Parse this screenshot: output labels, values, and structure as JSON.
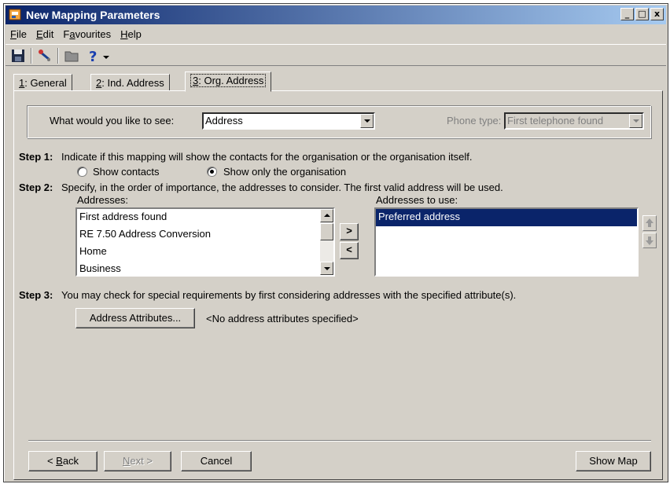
{
  "window": {
    "title": "New Mapping Parameters",
    "controls": {
      "minimize": "_",
      "maximize": "□",
      "close": "x"
    }
  },
  "menu": [
    {
      "key": "F",
      "rest": "ile"
    },
    {
      "key": "E",
      "rest": "dit"
    },
    {
      "pre": "F",
      "key": "a",
      "rest": "vourites"
    },
    {
      "key": "H",
      "rest": "elp"
    }
  ],
  "toolbar": {
    "icons": [
      "save-icon",
      "map-pin-icon",
      "folder-icon",
      "help-icon",
      "dropdown-arrow-icon"
    ]
  },
  "tabs": [
    {
      "key": "1",
      "rest": ": General"
    },
    {
      "key": "2",
      "rest": ": Ind. Address"
    },
    {
      "key": "3",
      "rest": ": Org. Address"
    }
  ],
  "view": {
    "label": "What would you like to see:",
    "value": "Address",
    "phone_label": "Phone type:",
    "phone_value": "First telephone found"
  },
  "step1": {
    "heading": "Step 1:",
    "text": "Indicate if this mapping will show the contacts for the organisation or the organisation itself.",
    "option_contacts": "Show contacts",
    "option_org": "Show only the organisation",
    "selected": "Show only the organisation"
  },
  "step2": {
    "heading": "Step 2:",
    "text": "Specify, in the order of importance, the addresses to consider.  The first valid address will be used.",
    "addresses_label": "Addresses:",
    "addresses": [
      "First address found",
      "RE 7.50 Address Conversion",
      "Home",
      "Business"
    ],
    "add_glyph": ">",
    "remove_glyph": "<",
    "use_label": "Addresses to use:",
    "use_list": [
      "Preferred address"
    ]
  },
  "step3": {
    "heading": "Step 3:",
    "text": "You may check for special requirements by first considering addresses with the specified attribute(s).",
    "button": "Address Attributes...",
    "status": "<No address attributes specified>"
  },
  "footer": {
    "back": {
      "pre": "< ",
      "key": "B",
      "rest": "ack"
    },
    "next": {
      "key": "N",
      "rest": "ext >"
    },
    "cancel": "Cancel",
    "show_map": "Show Map"
  }
}
